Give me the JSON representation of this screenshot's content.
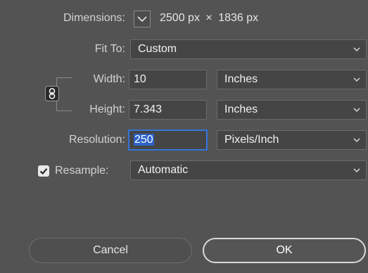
{
  "dimensions": {
    "label": "Dimensions:",
    "width_value": "2500 px",
    "times": "×",
    "height_value": "1836 px"
  },
  "fit_to": {
    "label": "Fit To:",
    "value": "Custom"
  },
  "width": {
    "label": "Width:",
    "value": "10",
    "unit": "Inches"
  },
  "height": {
    "label": "Height:",
    "value": "7.343",
    "unit": "Inches"
  },
  "resolution": {
    "label": "Resolution:",
    "value": "250",
    "unit": "Pixels/Inch"
  },
  "resample": {
    "label": "Resample:",
    "checked": true,
    "value": "Automatic"
  },
  "buttons": {
    "cancel": "Cancel",
    "ok": "OK"
  },
  "icons": {
    "dimensions_toggle": "chevron-down-icon",
    "constrain": "link-chain-icon",
    "select_arrow": "chevron-down-icon",
    "checkbox": "checkmark-icon"
  },
  "colors": {
    "background": "#535353",
    "field": "#454545",
    "focus_ring": "#3a7be0",
    "selection": "#2e62c8"
  }
}
